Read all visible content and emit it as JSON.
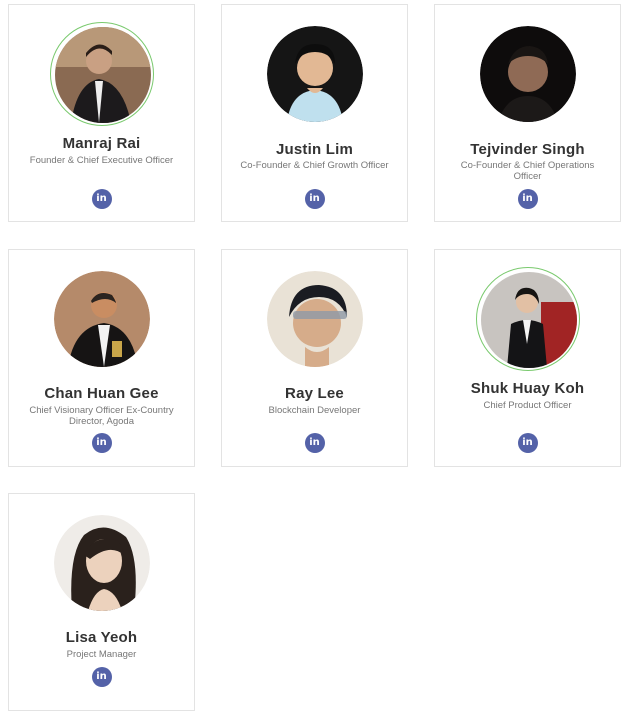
{
  "team": [
    {
      "name": "Manraj Rai",
      "role": "Founder & Chief Executive Officer",
      "social": "in",
      "avatar_icon": "portrait-photo",
      "highlighted": true
    },
    {
      "name": "Justin Lim",
      "role": "Co-Founder & Chief Growth Officer",
      "social": "in",
      "avatar_icon": "portrait-photo",
      "highlighted": false
    },
    {
      "name": "Tejvinder Singh",
      "role": "Co-Founder & Chief Operations Officer",
      "social": "in",
      "avatar_icon": "portrait-photo",
      "highlighted": false
    },
    {
      "name": "Chan Huan Gee",
      "role": "Chief Visionary Officer Ex-Country Director, Agoda",
      "social": "in",
      "avatar_icon": "portrait-photo",
      "highlighted": false
    },
    {
      "name": "Ray Lee",
      "role": "Blockchain Developer",
      "social": "in",
      "avatar_icon": "portrait-photo",
      "highlighted": false
    },
    {
      "name": "Shuk Huay Koh",
      "role": "Chief Product Officer",
      "social": "in",
      "avatar_icon": "portrait-photo",
      "highlighted": true
    },
    {
      "name": "Lisa Yeoh",
      "role": "Project Manager",
      "social": "in",
      "avatar_icon": "portrait-photo",
      "highlighted": false
    }
  ],
  "colors": {
    "linkedin": "#5462a8",
    "ring": "#79c96d",
    "name": "#333333",
    "role": "#777777",
    "border": "#e3e3e3"
  }
}
